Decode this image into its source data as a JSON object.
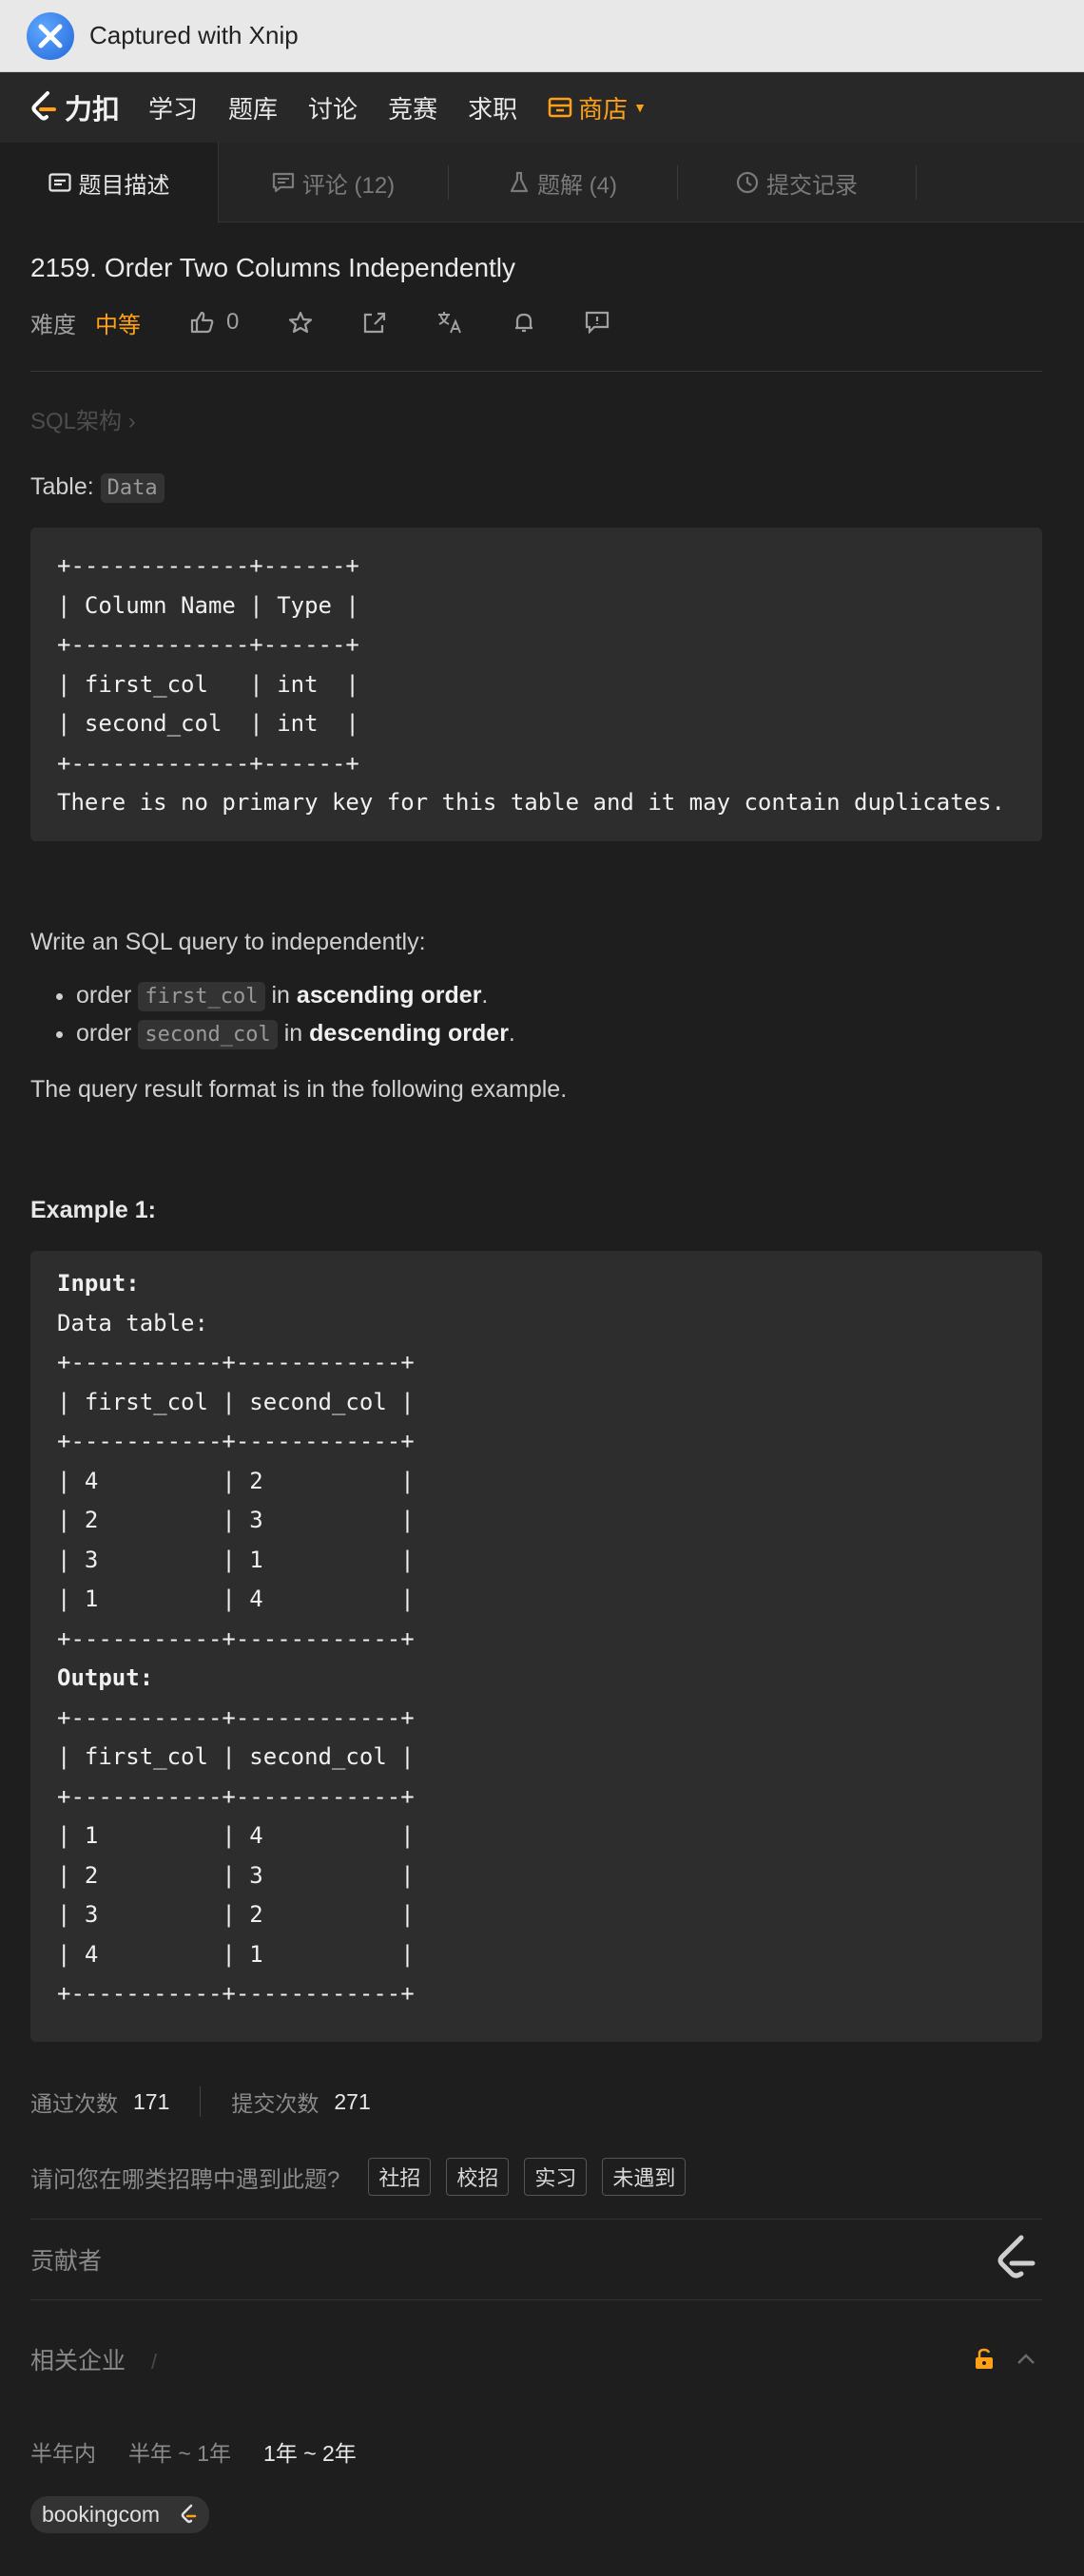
{
  "capture": {
    "text": "Captured with Xnip"
  },
  "nav": {
    "brand": "力扣",
    "items": [
      "学习",
      "题库",
      "讨论",
      "竞赛",
      "求职"
    ],
    "store": "商店"
  },
  "tabs": {
    "description": "题目描述",
    "comments": "评论 (12)",
    "solutions": "题解 (4)",
    "submissions": "提交记录"
  },
  "problem": {
    "title": "2159. Order Two Columns Independently",
    "difficulty_label": "难度",
    "difficulty": "中等",
    "likes": "0",
    "breadcrumb": "SQL架构 ›"
  },
  "body": {
    "table_prefix": "Table:",
    "table_name": "Data",
    "schema_block": "+-------------+------+\n| Column Name | Type |\n+-------------+------+\n| first_col   | int  |\n| second_col  | int  |\n+-------------+------+\nThere is no primary key for this table and it may contain duplicates.",
    "intro": "Write an SQL query to independently:",
    "bullet1": {
      "pre": "order",
      "code": "first_col",
      "mid": "in",
      "bold": "ascending order",
      "post": "."
    },
    "bullet2": {
      "pre": "order",
      "code": "second_col",
      "mid": "in",
      "bold": "descending order",
      "post": "."
    },
    "result_note": "The query result format is in the following example.",
    "example_title": "Example 1:",
    "input_label": "Input:",
    "input_block": "Data table:\n+-----------+------------+\n| first_col | second_col |\n+-----------+------------+\n| 4         | 2          |\n| 2         | 3          |\n| 3         | 1          |\n| 1         | 4          |\n+-----------+------------+",
    "output_label": "Output:",
    "output_block": "+-----------+------------+\n| first_col | second_col |\n+-----------+------------+\n| 1         | 4          |\n| 2         | 3          |\n| 3         | 2          |\n| 4         | 1          |\n+-----------+------------+"
  },
  "stats": {
    "accepted_label": "通过次数",
    "accepted": "171",
    "submitted_label": "提交次数",
    "submitted": "271"
  },
  "survey": {
    "question": "请问您在哪类招聘中遇到此题?",
    "options": [
      "社招",
      "校招",
      "实习",
      "未遇到"
    ]
  },
  "contributors": {
    "label": "贡献者"
  },
  "companies": {
    "label": "相关企业",
    "slash": "/",
    "time_tabs": [
      "半年内",
      "半年 ~ 1年",
      "1年 ~ 2年"
    ],
    "selected_time": 2,
    "tag": "bookingcom"
  },
  "colors": {
    "accent": "#ffa116",
    "background": "#1e1e1e",
    "code_bg": "#2d2d2d"
  }
}
